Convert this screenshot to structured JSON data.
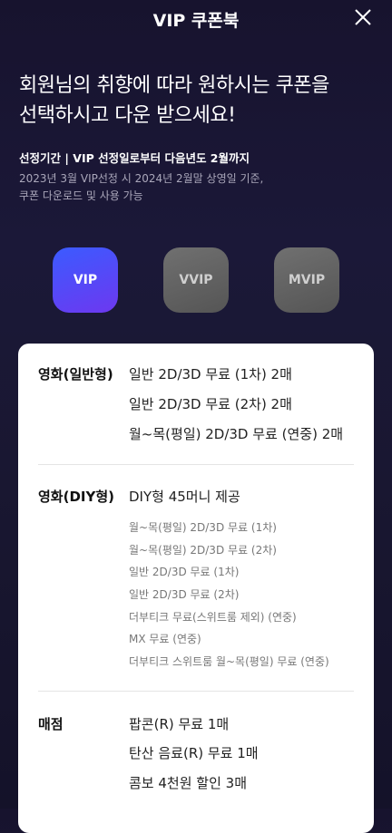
{
  "header": {
    "title": "VIP 쿠폰북"
  },
  "headline": {
    "line1": "회원님의 취향에 따라 원하시는 쿠폰을",
    "line2": "선택하시고 다운 받으세요!"
  },
  "period": "선정기간 | VIP 선정일로부터 다음년도 2월까지",
  "note": {
    "line1": "2023년 3월 VIP선정 시 2024년 2월말 상영일 기준,",
    "line2": "쿠폰 다운로드 및 사용 가능"
  },
  "tiers": [
    {
      "label": "VIP",
      "selected": true
    },
    {
      "label": "VVIP",
      "selected": false
    },
    {
      "label": "MVIP",
      "selected": false
    }
  ],
  "sections": {
    "general": {
      "label": "영화(일반형)",
      "items": [
        "일반 2D/3D 무료 (1차) 2매",
        "일반 2D/3D 무료 (2차) 2매",
        "월~목(평일) 2D/3D 무료 (연중) 2매"
      ]
    },
    "diy": {
      "label": "영화(DIY형)",
      "main": "DIY형 45머니 제공",
      "items": [
        "월~목(평일) 2D/3D 무료 (1차)",
        "월~목(평일) 2D/3D 무료 (2차)",
        "일반 2D/3D 무료 (1차)",
        "일반 2D/3D 무료 (2차)",
        "더부티크 무료(스위트룸 제외) (연중)",
        "MX 무료 (연중)",
        "더부티크 스위트룸 월~목(평일) 무료 (연중)"
      ]
    },
    "store": {
      "label": "매점",
      "items": [
        "팝콘(R) 무료 1매",
        "탄산 음료(R) 무료 1매",
        "콤보 4천원 할인 3매"
      ]
    }
  },
  "colors": {
    "vip_gradient_start": "#3b5bff",
    "vip_gradient_end": "#6d38f0",
    "inactive_tier": "#666666",
    "background": "#17132e"
  }
}
